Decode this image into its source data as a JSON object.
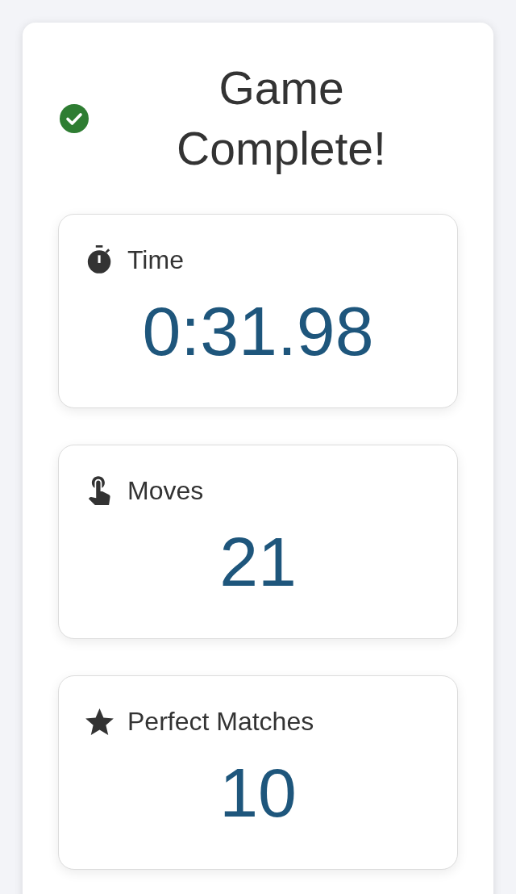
{
  "header": {
    "title": "Game Complete!"
  },
  "stats": [
    {
      "kind": "time",
      "label": "Time",
      "value": "0:31.98"
    },
    {
      "kind": "moves",
      "label": "Moves",
      "value": "21"
    },
    {
      "kind": "perfect",
      "label": "Perfect Matches",
      "value": "10"
    }
  ]
}
